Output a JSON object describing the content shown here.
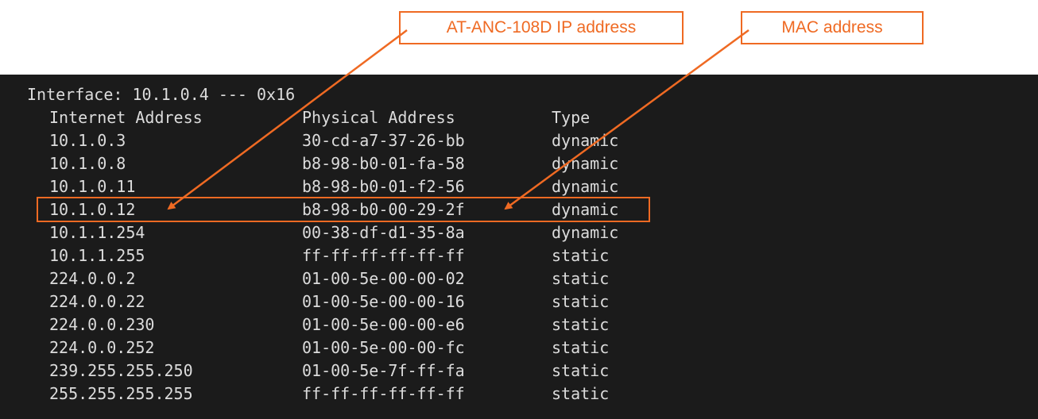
{
  "callouts": {
    "ip_label": "AT-ANC-108D IP address",
    "mac_label": "MAC address"
  },
  "terminal": {
    "interface_line": "Interface: 10.1.0.4 --- 0x16",
    "headers": {
      "internet_address": "Internet Address",
      "physical_address": "Physical Address",
      "type": "Type"
    },
    "rows": [
      {
        "ip": "10.1.0.3",
        "mac": "30-cd-a7-37-26-bb",
        "type": "dynamic"
      },
      {
        "ip": "10.1.0.8",
        "mac": "b8-98-b0-01-fa-58",
        "type": "dynamic"
      },
      {
        "ip": "10.1.0.11",
        "mac": "b8-98-b0-01-f2-56",
        "type": "dynamic"
      },
      {
        "ip": "10.1.0.12",
        "mac": "b8-98-b0-00-29-2f",
        "type": "dynamic"
      },
      {
        "ip": "10.1.1.254",
        "mac": "00-38-df-d1-35-8a",
        "type": "dynamic"
      },
      {
        "ip": "10.1.1.255",
        "mac": "ff-ff-ff-ff-ff-ff",
        "type": "static"
      },
      {
        "ip": "224.0.0.2",
        "mac": "01-00-5e-00-00-02",
        "type": "static"
      },
      {
        "ip": "224.0.0.22",
        "mac": "01-00-5e-00-00-16",
        "type": "static"
      },
      {
        "ip": "224.0.0.230",
        "mac": "01-00-5e-00-00-e6",
        "type": "static"
      },
      {
        "ip": "224.0.0.252",
        "mac": "01-00-5e-00-00-fc",
        "type": "static"
      },
      {
        "ip": "239.255.255.250",
        "mac": "01-00-5e-7f-ff-fa",
        "type": "static"
      },
      {
        "ip": "255.255.255.255",
        "mac": "ff-ff-ff-ff-ff-ff",
        "type": "static"
      }
    ]
  },
  "colors": {
    "accent": "#ef6a23",
    "terminal_background": "#1b1b1b",
    "terminal_text": "#dcdcdc"
  }
}
